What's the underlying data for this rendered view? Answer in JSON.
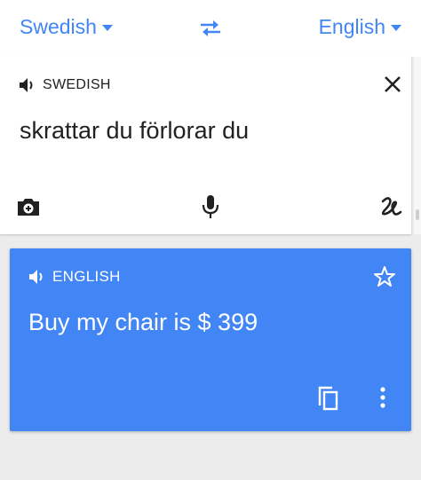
{
  "colors": {
    "accent": "#4285f4",
    "text": "#212121",
    "result_bg": "#4285f4",
    "background": "#ececec"
  },
  "topbar": {
    "source_language": "Swedish",
    "target_language": "English",
    "swap_icon": "swap-arrows-icon"
  },
  "input": {
    "language_label": "SWEDISH",
    "text": "skrattar du förlorar du",
    "icons": [
      "speaker-icon",
      "close-icon",
      "camera-icon",
      "microphone-icon",
      "handwriting-icon"
    ]
  },
  "result": {
    "language_label": "ENGLISH",
    "text": "Buy my chair is $ 399",
    "icons": [
      "speaker-icon",
      "star-icon",
      "copy-icon",
      "more-vert-icon"
    ]
  }
}
